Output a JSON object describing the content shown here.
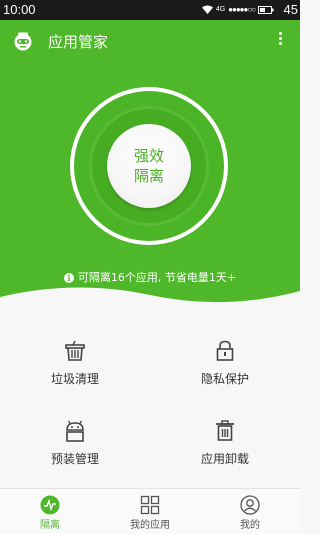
{
  "status_bar": {
    "time": "10:00",
    "network": "4G",
    "signal_dots": "●●●●●○○",
    "battery": "45"
  },
  "header": {
    "title": "应用管家",
    "logo_icon": "robot-logo-icon",
    "menu_icon": "more-vertical-icon"
  },
  "hero": {
    "boost_line1": "强效",
    "boost_line2": "隔离",
    "tip": "可隔离16个应用, 节省电量1天+",
    "tip_icon": "info-icon"
  },
  "features": [
    {
      "label": "垃圾清理",
      "icon": "trash-basket-icon"
    },
    {
      "label": "隐私保护",
      "icon": "lock-icon"
    },
    {
      "label": "预装管理",
      "icon": "android-icon"
    },
    {
      "label": "应用卸载",
      "icon": "trash-can-icon"
    }
  ],
  "bottom_nav": [
    {
      "label": "隔离",
      "icon": "pulse-icon",
      "active": true
    },
    {
      "label": "我的应用",
      "icon": "apps-grid-icon",
      "active": false
    },
    {
      "label": "我的",
      "icon": "profile-icon",
      "active": false
    }
  ],
  "colors": {
    "accent": "#4fb82a",
    "status_bar": "#1a1a1a",
    "background": "#f7f7f7"
  }
}
